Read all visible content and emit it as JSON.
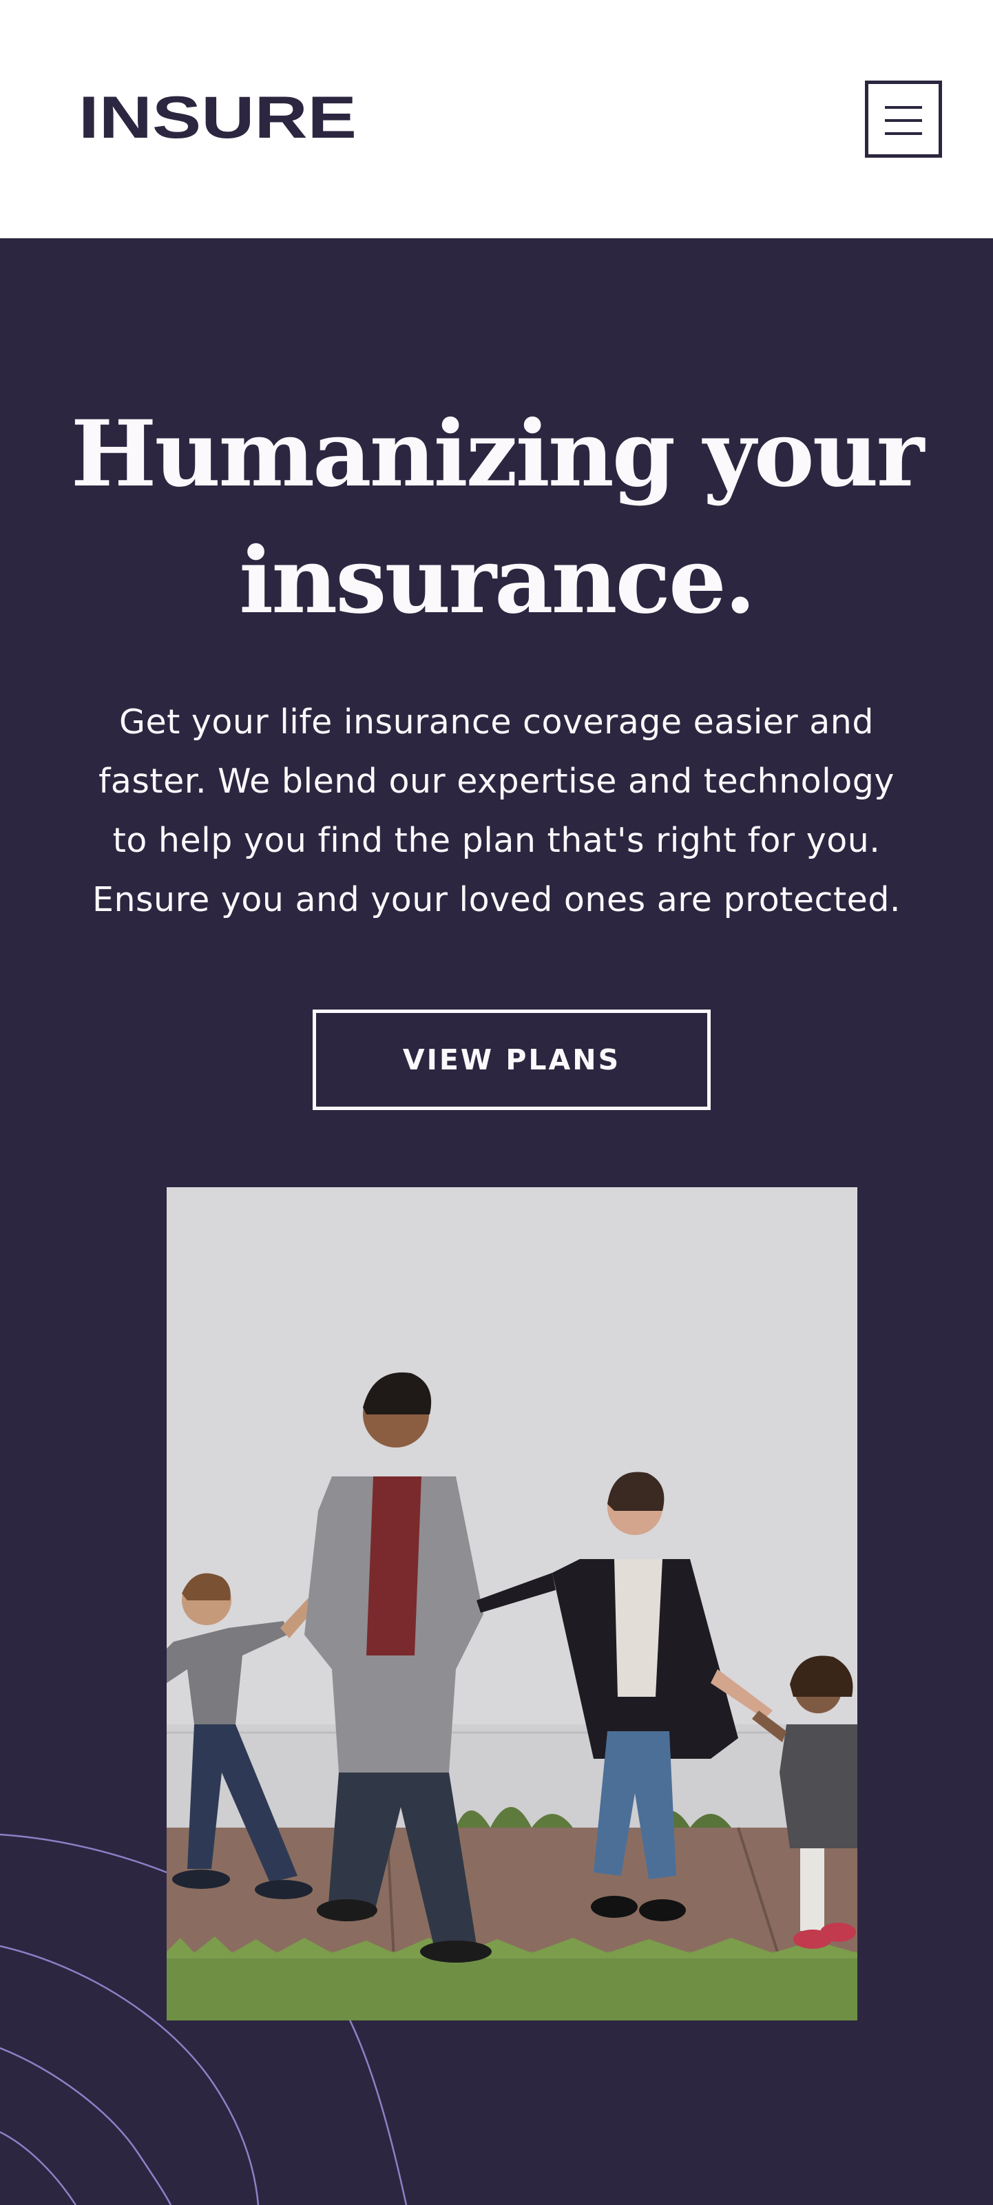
{
  "brand": {
    "name": "INSURE",
    "colors": {
      "dark_violet": "#2c2640",
      "light_grayish_violet": "#fbf9fc",
      "white": "#ffffff",
      "curve_violet": "#8c81c7"
    }
  },
  "header": {
    "logo_text": "INSURE",
    "menu_icon": "hamburger-icon"
  },
  "hero": {
    "title": "Humanizing your insurance.",
    "description": "Get your life insurance coverage easier and faster. We blend our expertise and technology to help you find the plan that's right for you. Ensure you and your loved ones are protected.",
    "cta_label": "VIEW PLANS",
    "image_subject": "family-photo",
    "decoration": "curved-lines"
  }
}
